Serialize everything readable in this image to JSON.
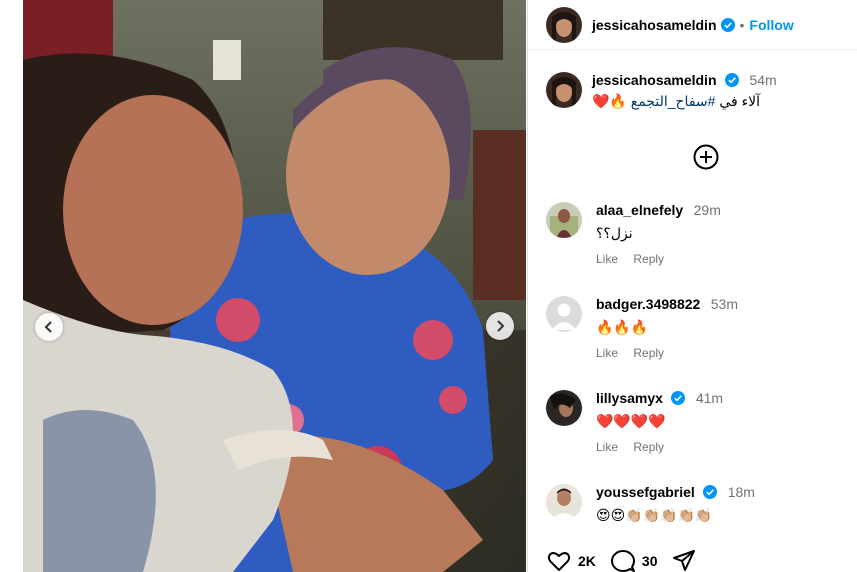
{
  "post": {
    "author": "jessicahosameldin",
    "follow_label": "Follow",
    "separator": "•"
  },
  "caption": {
    "author": "jessicahosameldin",
    "time": "54m",
    "text_prefix": "ﺁﻻﺀ ﻓﻲ",
    "hashtag": "#سفاح_التجمع",
    "emojis": "🔥❤️"
  },
  "comments": [
    {
      "user": "alaa_elnefely",
      "time": "29m",
      "text": "نزل؟؟",
      "verified": false,
      "like_label": "Like",
      "reply_label": "Reply"
    },
    {
      "user": "badger.3498822",
      "time": "53m",
      "text": "🔥🔥🔥",
      "verified": false,
      "like_label": "Like",
      "reply_label": "Reply"
    },
    {
      "user": "lillysamyx",
      "time": "41m",
      "text": "❤️❤️❤️❤️",
      "verified": true,
      "like_label": "Like",
      "reply_label": "Reply"
    },
    {
      "user": "youssefgabriel",
      "time": "18m",
      "text": "😍😍👏🏼👏🏼👏🏼👏🏼👏🏼",
      "verified": true
    }
  ],
  "footer": {
    "likes": "2K",
    "comments_count": "30"
  },
  "colors": {
    "link": "#0095f6",
    "hashtag": "#00376b",
    "muted": "#737373",
    "verified": "#0095f6"
  },
  "icons": {
    "prev": "chevron-left-icon",
    "next": "chevron-right-icon",
    "add": "plus-circle-icon",
    "like": "heart-icon",
    "comment": "comment-bubble-icon",
    "share": "paper-plane-icon"
  }
}
